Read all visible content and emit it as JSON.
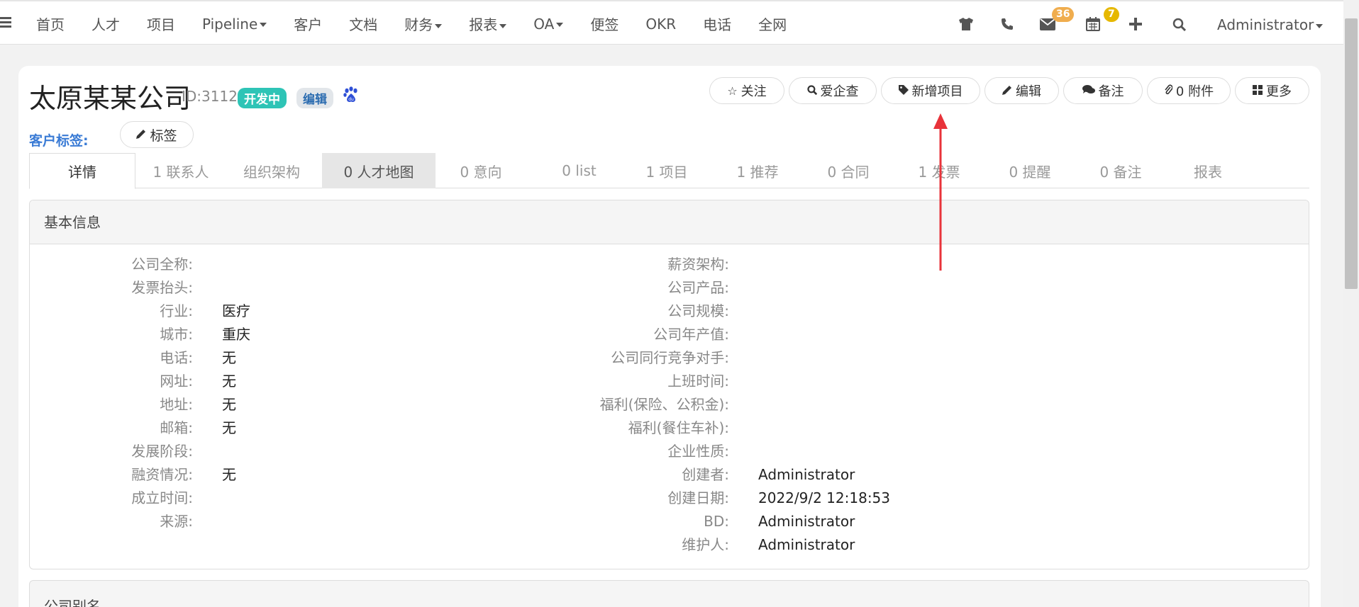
{
  "nav": {
    "items": [
      {
        "label": "首页",
        "dropdown": false
      },
      {
        "label": "人才",
        "dropdown": false
      },
      {
        "label": "项目",
        "dropdown": false
      },
      {
        "label": "Pipeline",
        "dropdown": true
      },
      {
        "label": "客户",
        "dropdown": false
      },
      {
        "label": "文档",
        "dropdown": false
      },
      {
        "label": "财务",
        "dropdown": true
      },
      {
        "label": "报表",
        "dropdown": true
      },
      {
        "label": "OA",
        "dropdown": true
      },
      {
        "label": "便签",
        "dropdown": false
      },
      {
        "label": "OKR",
        "dropdown": false
      },
      {
        "label": "电话",
        "dropdown": false
      },
      {
        "label": "全网",
        "dropdown": false
      }
    ],
    "icons": [
      "shirt-icon",
      "phone-icon",
      "mail-icon",
      "calendar-icon",
      "plus-icon",
      "search-icon"
    ],
    "mail_badge": "36",
    "calendar_badge": "7",
    "user": "Administrator",
    "colors": {
      "mail_badge": "#f0ad4e",
      "calendar_badge": "#e6b800"
    }
  },
  "company": {
    "name": "太原某某公司",
    "id": "ID:3112",
    "status": "开发中",
    "edit_tag": "编辑",
    "status_color": "#2ec4b6"
  },
  "actions": {
    "follow": "关注",
    "aiqicha": "爱企查",
    "new_project": "新增项目",
    "edit": "编辑",
    "note": "备注",
    "attachment": "0 附件",
    "more": "更多"
  },
  "customer_tags": {
    "label": "客户标签:",
    "button": "标签"
  },
  "tabs": [
    "详情",
    "1 联系人",
    "组织架构",
    "0 人才地图",
    "0 意向",
    "0 list",
    "1 项目",
    "1 推荐",
    "0 合同",
    "1 发票",
    "0 提醒",
    "0 备注",
    "报表"
  ],
  "basic_info": {
    "title": "基本信息",
    "left": [
      {
        "label": "公司全称:",
        "value": ""
      },
      {
        "label": "发票抬头:",
        "value": ""
      },
      {
        "label": "行业:",
        "value": "医疗"
      },
      {
        "label": "城市:",
        "value": "重庆"
      },
      {
        "label": "电话:",
        "value": "无"
      },
      {
        "label": "网址:",
        "value": "无"
      },
      {
        "label": "地址:",
        "value": "无"
      },
      {
        "label": "邮箱:",
        "value": "无"
      },
      {
        "label": "发展阶段:",
        "value": ""
      },
      {
        "label": "融资情况:",
        "value": "无"
      },
      {
        "label": "成立时间:",
        "value": ""
      },
      {
        "label": "来源:",
        "value": ""
      }
    ],
    "right": [
      {
        "label": "薪资架构:",
        "value": ""
      },
      {
        "label": "公司产品:",
        "value": ""
      },
      {
        "label": "公司规模:",
        "value": ""
      },
      {
        "label": "公司年产值:",
        "value": ""
      },
      {
        "label": "公司同行竞争对手:",
        "value": ""
      },
      {
        "label": "上班时间:",
        "value": ""
      },
      {
        "label": "福利(保险、公积金):",
        "value": ""
      },
      {
        "label": "福利(餐住车补):",
        "value": ""
      },
      {
        "label": "企业性质:",
        "value": ""
      },
      {
        "label": "创建者:",
        "value": "Administrator"
      },
      {
        "label": "创建日期:",
        "value": "2022/9/2 12:18:53"
      },
      {
        "label": "BD:",
        "value": "Administrator"
      },
      {
        "label": "维护人:",
        "value": "Administrator"
      }
    ]
  },
  "alias_panel": {
    "title": "公司别名"
  },
  "annotation": {
    "color": "#e8333a"
  }
}
